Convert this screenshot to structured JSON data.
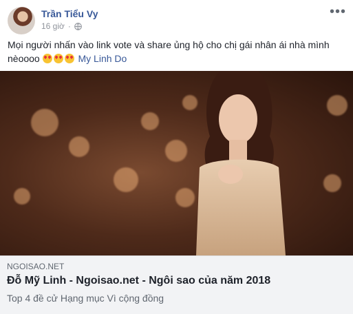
{
  "post": {
    "author": "Trần Tiểu Vy",
    "timestamp": "16 giờ",
    "privacy_icon": "globe-icon",
    "menu_icon": "more-options-icon",
    "text": "Mọi người nhấn vào link vote và share ủng hộ cho chị gái nhân ái nhà mình nèoooo",
    "emoji_icon": "heart-eyes-emoji",
    "tagged_user": "My Linh Do"
  },
  "link_preview": {
    "domain": "NGOISAO.NET",
    "title": "Đỗ Mỹ Linh - Ngoisao.net - Ngôi sao của năm 2018",
    "description": "Top 4 đề cử Hạng mục Vì cộng đồng"
  }
}
